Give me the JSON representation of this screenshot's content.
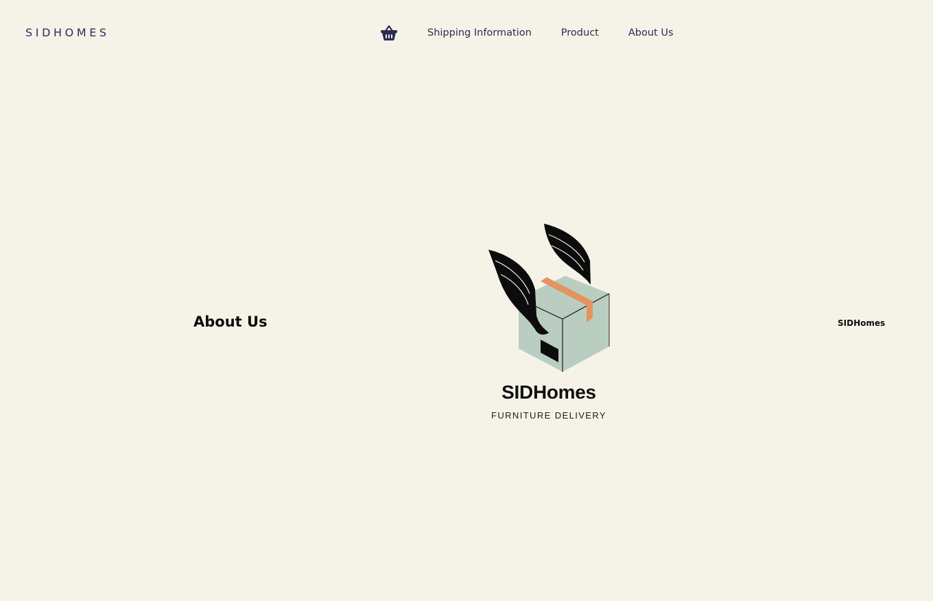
{
  "header": {
    "brand": "SIDHOMES",
    "nav": {
      "cart_icon": "shopping-basket-icon",
      "shipping": "Shipping Information",
      "product": "Product",
      "about": "About Us"
    }
  },
  "main": {
    "heading": "About Us",
    "side_brand": "SIDHomes",
    "logo": {
      "title": "SIDHomes",
      "subtitle": "FURNITURE DELIVERY",
      "icon": "winged-box-icon"
    }
  },
  "colors": {
    "background": "#f5f3e8",
    "nav_text": "#2d2a55",
    "box": "#b9cec1",
    "tape": "#e39461",
    "wings": "#0c0c0c"
  }
}
